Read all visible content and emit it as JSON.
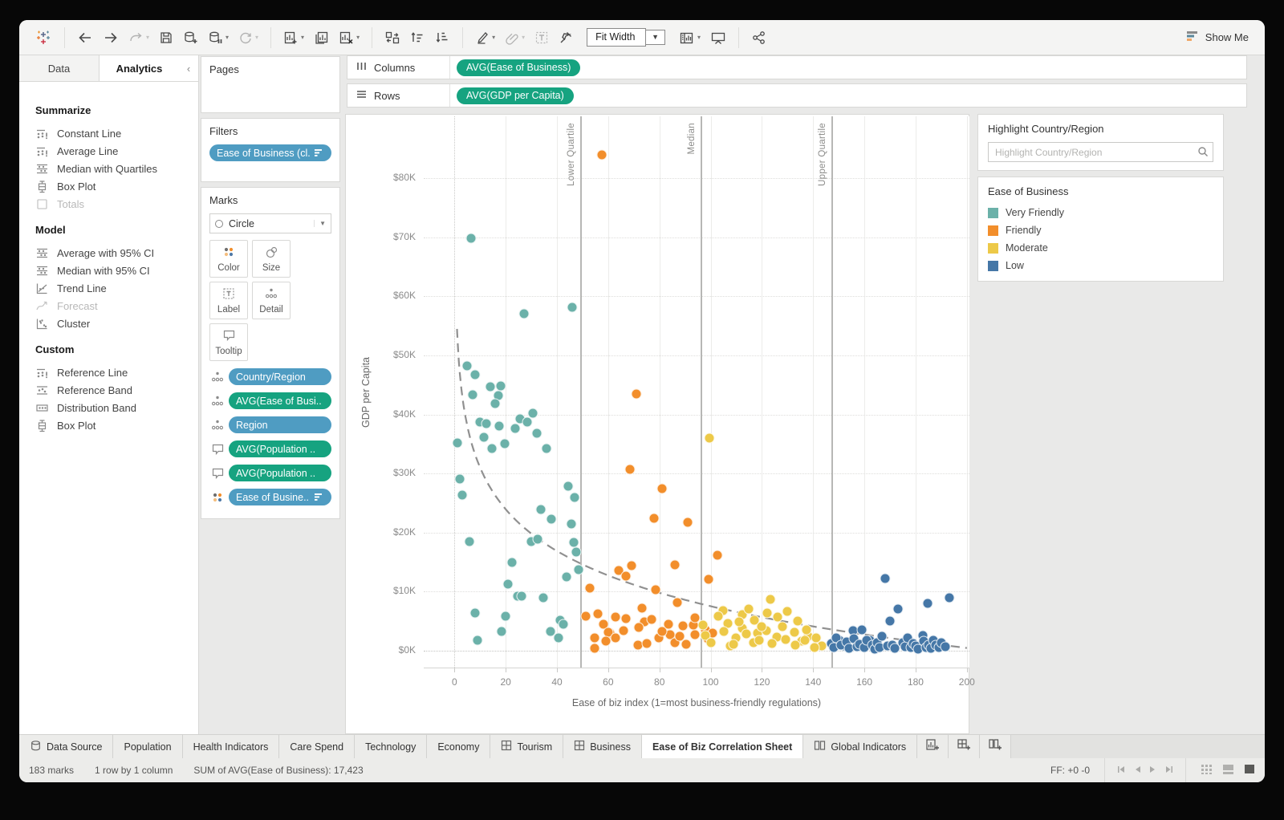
{
  "toolbar": {
    "fit_mode": "Fit Width",
    "show_me": "Show Me"
  },
  "sidebar": {
    "tabs": [
      {
        "label": "Data",
        "active": false
      },
      {
        "label": "Analytics",
        "active": true
      }
    ],
    "sections": [
      {
        "title": "Summarize",
        "items": [
          {
            "icon": "constant-line",
            "label": "Constant Line",
            "disabled": false
          },
          {
            "icon": "constant-line",
            "label": "Average Line",
            "disabled": false
          },
          {
            "icon": "ci-band",
            "label": "Median with Quartiles",
            "disabled": false
          },
          {
            "icon": "box-plot",
            "label": "Box Plot",
            "disabled": false
          },
          {
            "icon": "totals",
            "label": "Totals",
            "disabled": true
          }
        ]
      },
      {
        "title": "Model",
        "items": [
          {
            "icon": "ci-band",
            "label": "Average with 95% CI",
            "disabled": false
          },
          {
            "icon": "ci-band",
            "label": "Median with 95% CI",
            "disabled": false
          },
          {
            "icon": "trend-line",
            "label": "Trend Line",
            "disabled": false
          },
          {
            "icon": "forecast",
            "label": "Forecast",
            "disabled": true
          },
          {
            "icon": "cluster",
            "label": "Cluster",
            "disabled": false
          }
        ]
      },
      {
        "title": "Custom",
        "items": [
          {
            "icon": "constant-line",
            "label": "Reference Line",
            "disabled": false
          },
          {
            "icon": "ref-band",
            "label": "Reference Band",
            "disabled": false
          },
          {
            "icon": "dist-band",
            "label": "Distribution Band",
            "disabled": false
          },
          {
            "icon": "box-plot",
            "label": "Box Plot",
            "disabled": false
          }
        ]
      }
    ]
  },
  "cards": {
    "pages": {
      "title": "Pages"
    },
    "filters": {
      "title": "Filters",
      "pills": [
        {
          "label": "Ease of Business (cl..",
          "color": "blue",
          "suffix_icon": "sort-bars"
        }
      ]
    },
    "marks": {
      "title": "Marks",
      "mark_type": "Circle",
      "buttons": [
        {
          "icon": "color",
          "label": "Color"
        },
        {
          "icon": "size",
          "label": "Size"
        },
        {
          "icon": "label",
          "label": "Label"
        },
        {
          "icon": "detail",
          "label": "Detail"
        },
        {
          "icon": "tooltip",
          "label": "Tooltip"
        }
      ],
      "pills": [
        {
          "icon": "detail",
          "label": "Country/Region",
          "color": "blue"
        },
        {
          "icon": "detail",
          "label": "AVG(Ease of Busi..",
          "color": "green"
        },
        {
          "icon": "detail",
          "label": "Region",
          "color": "blue"
        },
        {
          "icon": "tooltip",
          "label": "AVG(Population ..",
          "color": "green"
        },
        {
          "icon": "tooltip",
          "label": "AVG(Population ..",
          "color": "green"
        },
        {
          "icon": "color",
          "label": "Ease of Busine..",
          "color": "blue",
          "suffix_icon": "sort-bars"
        }
      ]
    }
  },
  "shelves": {
    "columns": {
      "label": "Columns",
      "pills": [
        "AVG(Ease of Business)"
      ]
    },
    "rows": {
      "label": "Rows",
      "pills": [
        "AVG(GDP per Capita)"
      ]
    }
  },
  "right_panel": {
    "highlight": {
      "title": "Highlight Country/Region",
      "placeholder": "Highlight Country/Region"
    },
    "legend": {
      "title": "Ease of Business",
      "items": [
        {
          "label": "Very Friendly",
          "color": "#6BB1A9"
        },
        {
          "label": "Friendly",
          "color": "#F28E2B"
        },
        {
          "label": "Moderate",
          "color": "#EDC948"
        },
        {
          "label": "Low",
          "color": "#4577A7"
        }
      ]
    }
  },
  "chart_data": {
    "type": "scatter",
    "xlabel": "Ease of biz index (1=most business-friendly regulations)",
    "ylabel": "GDP per Capita",
    "xlim": [
      -12,
      201
    ],
    "ylim_thousands": [
      -3,
      90.5
    ],
    "x_ticks": [
      0,
      20,
      40,
      60,
      80,
      100,
      120,
      140,
      160,
      180,
      200
    ],
    "y_ticks": [
      {
        "value": 0,
        "label": "$0K"
      },
      {
        "value": 10,
        "label": "$10K"
      },
      {
        "value": 20,
        "label": "$20K"
      },
      {
        "value": 30,
        "label": "$30K"
      },
      {
        "value": 40,
        "label": "$40K"
      },
      {
        "value": 50,
        "label": "$50K"
      },
      {
        "value": 60,
        "label": "$60K"
      },
      {
        "value": 70,
        "label": "$70K"
      },
      {
        "value": 80,
        "label": "$80K"
      }
    ],
    "grid": true,
    "legend_position": "right",
    "reference_lines": [
      {
        "x": 49,
        "label": "Lower Quartile"
      },
      {
        "x": 96,
        "label": "Median"
      },
      {
        "x": 147,
        "label": "Upper Quartile"
      }
    ],
    "trend_line": {
      "model": "y_thousands = a - b*ln(x)",
      "a": 54.5,
      "b": 10.2,
      "x_start": 1.0,
      "x_end": 200,
      "style": "dashed",
      "color": "#909090"
    },
    "series": [
      {
        "name": "Very Friendly",
        "color": "#6BB1A9",
        "points": [
          [
            1,
            35.2
          ],
          [
            2,
            29.1
          ],
          [
            3,
            26.4
          ],
          [
            5,
            48.2
          ],
          [
            6.5,
            69.8
          ],
          [
            7,
            43.4
          ],
          [
            8,
            46.8
          ],
          [
            6,
            18.5
          ],
          [
            8,
            6.4
          ],
          [
            9,
            1.8
          ],
          [
            10,
            38.7
          ],
          [
            11.5,
            36.1
          ],
          [
            12.5,
            38.5
          ],
          [
            14.5,
            34.2
          ],
          [
            14,
            44.7
          ],
          [
            17.5,
            38
          ],
          [
            17,
            43.2
          ],
          [
            18,
            44.8
          ],
          [
            16,
            41.9
          ],
          [
            19.5,
            35
          ],
          [
            18.5,
            3.3
          ],
          [
            20,
            5.8
          ],
          [
            21,
            11.3
          ],
          [
            22.5,
            14.9
          ],
          [
            23.8,
            37.7
          ],
          [
            24.7,
            9.2
          ],
          [
            25.6,
            39.3
          ],
          [
            26.3,
            9.2
          ],
          [
            27,
            57.1
          ],
          [
            28.4,
            38.7
          ],
          [
            30,
            18.5
          ],
          [
            30.6,
            40.2
          ],
          [
            32.2,
            36.8
          ],
          [
            32.5,
            18.9
          ],
          [
            33.8,
            23.9
          ],
          [
            34.7,
            9
          ],
          [
            35.9,
            34.3
          ],
          [
            37.5,
            3.3
          ],
          [
            37.8,
            22.3
          ],
          [
            40.6,
            2.2
          ],
          [
            41.3,
            5.2
          ],
          [
            42.5,
            4.5
          ],
          [
            43.8,
            12.5
          ],
          [
            46,
            58.1
          ],
          [
            46.9,
            26
          ],
          [
            46.6,
            18.3
          ],
          [
            47.5,
            16.7
          ],
          [
            44.5,
            27.8
          ],
          [
            45.5,
            21.5
          ],
          [
            48.5,
            13.7
          ]
        ]
      },
      {
        "name": "Friendly",
        "color": "#F28E2B",
        "points": [
          [
            57.5,
            84
          ],
          [
            71,
            43.5
          ],
          [
            68.5,
            30.7
          ],
          [
            80.9,
            27.4
          ],
          [
            77.8,
            22.4
          ],
          [
            90.9,
            21.7
          ],
          [
            102.5,
            16.1
          ],
          [
            69.1,
            14.4
          ],
          [
            64.1,
            13.6
          ],
          [
            66.9,
            12.6
          ],
          [
            78.4,
            10.3
          ],
          [
            85.9,
            14.5
          ],
          [
            99.1,
            12.1
          ],
          [
            52.8,
            10.6
          ],
          [
            86.9,
            8.1
          ],
          [
            51.3,
            5.8
          ],
          [
            58.1,
            4.5
          ],
          [
            60.6,
            3
          ],
          [
            62.8,
            5.7
          ],
          [
            73.1,
            7.2
          ],
          [
            74.1,
            4.9
          ],
          [
            76.9,
            5.3
          ],
          [
            54.7,
            2.2
          ],
          [
            54.7,
            0.4
          ],
          [
            65.9,
            3.4
          ],
          [
            60,
            3.1
          ],
          [
            71.6,
            1
          ],
          [
            83.4,
            4.5
          ],
          [
            84.1,
            2.7
          ],
          [
            85.9,
            1.4
          ],
          [
            89.1,
            4.2
          ],
          [
            93.1,
            4.3
          ],
          [
            93.8,
            2.7
          ],
          [
            97.8,
            3.5
          ],
          [
            98.8,
            2
          ],
          [
            100.9,
            3
          ],
          [
            79.7,
            2.2
          ],
          [
            56,
            6.3
          ],
          [
            59,
            1.6
          ],
          [
            63,
            2.1
          ],
          [
            67,
            5.4
          ],
          [
            72,
            3.9
          ],
          [
            75,
            1.2
          ],
          [
            81,
            3.3
          ],
          [
            88,
            2.4
          ],
          [
            90.5,
            1.1
          ],
          [
            94,
            5.6
          ]
        ]
      },
      {
        "name": "Moderate",
        "color": "#EDC948",
        "points": [
          [
            99.5,
            36
          ],
          [
            123.4,
            8.7
          ],
          [
            104.7,
            6.8
          ],
          [
            106.6,
            4.6
          ],
          [
            112.2,
            6.1
          ],
          [
            112.5,
            3.8
          ],
          [
            118.4,
            3
          ],
          [
            121.9,
            3.4
          ],
          [
            125.9,
            2.3
          ],
          [
            129.4,
            1.9
          ],
          [
            132.8,
            3.1
          ],
          [
            135.6,
            1.6
          ],
          [
            138.1,
            2.4
          ],
          [
            110,
            2.2
          ],
          [
            107.8,
            0.8
          ],
          [
            116.6,
            1.4
          ],
          [
            137.5,
            3.5
          ],
          [
            136.9,
            1.8
          ],
          [
            141.3,
            2.2
          ],
          [
            143.4,
            0.8
          ],
          [
            140.6,
            0.5
          ],
          [
            97,
            4.4
          ],
          [
            98,
            2.6
          ],
          [
            100,
            1.3
          ],
          [
            103,
            5.9
          ],
          [
            105,
            3.2
          ],
          [
            109,
            1.1
          ],
          [
            111,
            4.9
          ],
          [
            114,
            2.8
          ],
          [
            115,
            7
          ],
          [
            117,
            5.2
          ],
          [
            119,
            1.7
          ],
          [
            120,
            4.1
          ],
          [
            122,
            6.4
          ],
          [
            124,
            1.2
          ],
          [
            126,
            5.7
          ],
          [
            128,
            4
          ],
          [
            130,
            6.6
          ],
          [
            133,
            1
          ],
          [
            134,
            5
          ]
        ]
      },
      {
        "name": "Low",
        "color": "#4577A7",
        "points": [
          [
            168,
            12.2
          ],
          [
            173.1,
            7.1
          ],
          [
            184.7,
            8
          ],
          [
            193.1,
            9
          ],
          [
            170,
            5
          ],
          [
            182.8,
            2.6
          ],
          [
            155.6,
            3.4
          ],
          [
            159.1,
            3.5
          ],
          [
            162.2,
            1.8
          ],
          [
            150.3,
            1.8
          ],
          [
            152.2,
            0.8
          ],
          [
            147,
            1.2
          ],
          [
            148,
            0.5
          ],
          [
            149,
            2.2
          ],
          [
            151,
            0.9
          ],
          [
            153,
            1.5
          ],
          [
            154,
            0.4
          ],
          [
            156,
            2
          ],
          [
            157,
            0.7
          ],
          [
            158,
            1.1
          ],
          [
            160,
            0.5
          ],
          [
            161,
            1.7
          ],
          [
            163,
            0.9
          ],
          [
            164,
            0.3
          ],
          [
            165,
            1.3
          ],
          [
            166,
            0.6
          ],
          [
            167,
            2.4
          ],
          [
            169,
            0.8
          ],
          [
            171,
            1
          ],
          [
            172,
            0.4
          ],
          [
            175,
            1.4
          ],
          [
            176,
            0.7
          ],
          [
            177,
            2.1
          ],
          [
            178,
            0.5
          ],
          [
            179,
            1.2
          ],
          [
            180,
            0.8
          ],
          [
            181,
            0.3
          ],
          [
            183,
            1.6
          ],
          [
            184,
            0.6
          ],
          [
            185,
            1
          ],
          [
            186,
            0.4
          ],
          [
            187,
            1.8
          ],
          [
            188,
            0.9
          ],
          [
            189,
            0.5
          ],
          [
            190,
            1.3
          ],
          [
            191.5,
            0.7
          ]
        ]
      }
    ]
  },
  "sheet_tabs": {
    "items": [
      {
        "label": "Data Source",
        "icon": "datasource",
        "active": false
      },
      {
        "label": "Population",
        "icon": "",
        "active": false
      },
      {
        "label": "Health Indicators",
        "icon": "",
        "active": false
      },
      {
        "label": "Care Spend",
        "icon": "",
        "active": false
      },
      {
        "label": "Technology",
        "icon": "",
        "active": false
      },
      {
        "label": "Economy",
        "icon": "",
        "active": false
      },
      {
        "label": "Tourism",
        "icon": "dashboard",
        "active": false
      },
      {
        "label": "Business",
        "icon": "dashboard",
        "active": false
      },
      {
        "label": "Ease of Biz Correlation Sheet",
        "icon": "",
        "active": true
      },
      {
        "label": "Global Indicators",
        "icon": "story",
        "active": false
      }
    ]
  },
  "status_bar": {
    "marks": "183 marks",
    "size": "1 row by 1 column",
    "aggregation": "SUM of AVG(Ease of Business): 17,423",
    "ff": "FF: +0 -0"
  }
}
